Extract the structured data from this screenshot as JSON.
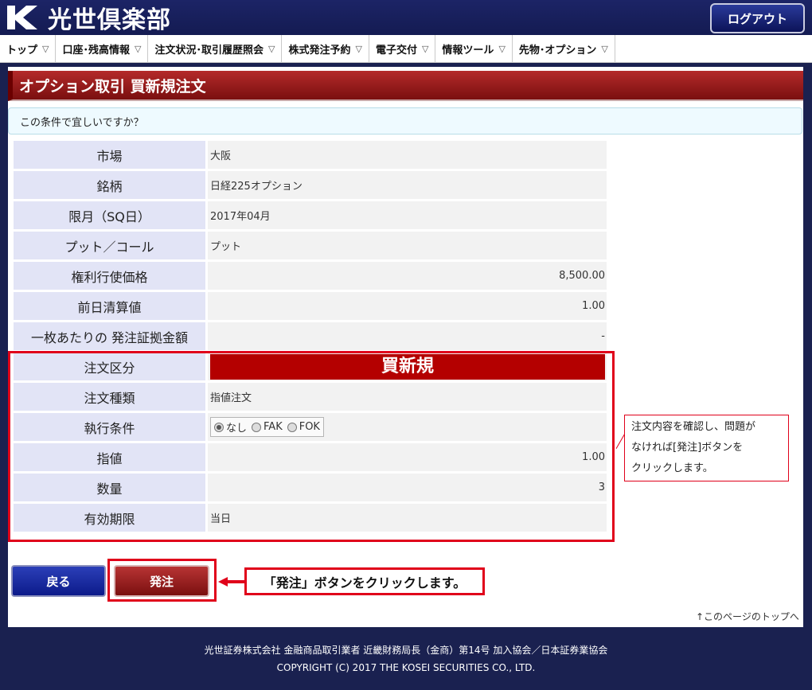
{
  "header": {
    "logo_mark": "K",
    "brand": "光世倶楽部",
    "logout_label": "ログアウト"
  },
  "nav": {
    "items": [
      {
        "label": "トップ"
      },
      {
        "label": "口座･残高情報"
      },
      {
        "label": "注文状況･取引履歴照会"
      },
      {
        "label": "株式発注予約"
      },
      {
        "label": "電子交付"
      },
      {
        "label": "情報ツール"
      },
      {
        "label": "先物･オプション"
      }
    ],
    "chevron": "▽"
  },
  "page": {
    "title": "オプション取引 買新規注文",
    "confirm_message": "この条件で宜しいですか？"
  },
  "details": [
    {
      "label": "市場",
      "value": "大阪"
    },
    {
      "label": "銘柄",
      "value": "日経225オプション"
    },
    {
      "label": "限月（SQ日）",
      "value": "2017年04月"
    },
    {
      "label": "プット／コール",
      "value": "プット"
    },
    {
      "label": "権利行使価格",
      "value": "8,500.00"
    },
    {
      "label": "前日清算値",
      "value": "1.00"
    },
    {
      "label": "一枚あたりの 発注証拠金額",
      "value": "-"
    },
    {
      "label": "注文区分",
      "value": "買新規"
    },
    {
      "label": "注文種類",
      "value": "指値注文"
    },
    {
      "label": "執行条件",
      "options": [
        "なし",
        "FAK",
        "FOK"
      ],
      "selected": "なし"
    },
    {
      "label": "指値",
      "value": "1.00"
    },
    {
      "label": "数量",
      "value": "3"
    },
    {
      "label": "有効期限",
      "value": "当日"
    }
  ],
  "callout": {
    "text1": "注文内容を確認し、問題が",
    "text2": "なければ[発注]ボタンを",
    "text3": "クリックします。"
  },
  "actions": {
    "back_label": "戻る",
    "order_label": "発注",
    "arrow_note": "「発注」ボタンをクリックします。",
    "page_top_label": "↑このページのトップへ"
  },
  "footer": {
    "line1": "光世証券株式会社 金融商品取引業者 近畿財務局長（金商）第14号 加入協会／日本証券業協会",
    "line2": "COPYRIGHT (C) 2017 THE KOSEI SECURITIES CO., LTD."
  },
  "colors": {
    "header_bg": "#1c2466",
    "title_red": "#9a1a1a",
    "label_bg": "#e2e4f6",
    "highlight_red": "#e0001a"
  }
}
